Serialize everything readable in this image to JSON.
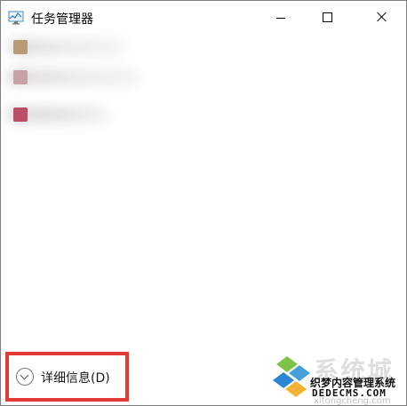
{
  "window": {
    "title": "任务管理器"
  },
  "titlebar": {
    "minimize_icon": "minimize-icon",
    "maximize_icon": "maximize-icon",
    "close_icon": "close-icon"
  },
  "processes": [
    {
      "name": "",
      "icon_color": "#b69b74"
    },
    {
      "name": "",
      "icon_color": "#c6a3a6"
    },
    {
      "name": "",
      "icon_color": "#bb4f67"
    }
  ],
  "footer": {
    "details_label": "详细信息(D)",
    "details_icon": "chevron-down-circle-icon",
    "highlight_color": "#e53935"
  },
  "watermark": {
    "main": "系统城",
    "sub": "织梦内容管理系统",
    "domain": "DEDECMS.COM",
    "site": "xitongcheng.com"
  }
}
